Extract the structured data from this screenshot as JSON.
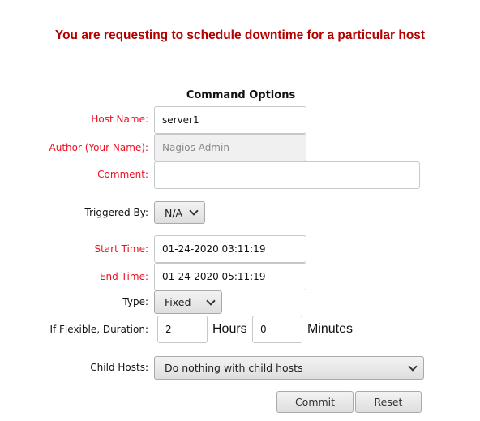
{
  "title": "You are requesting to schedule downtime for a particular host",
  "section_title": "Command Options",
  "fields": {
    "host_name": {
      "label": "Host Name:",
      "value": "server1"
    },
    "author": {
      "label": "Author (Your Name):",
      "value": "Nagios Admin"
    },
    "comment": {
      "label": "Comment:",
      "value": ""
    },
    "triggered_by": {
      "label": "Triggered By:",
      "value": "N/A"
    },
    "start_time": {
      "label": "Start Time:",
      "value": "01-24-2020 03:11:19"
    },
    "end_time": {
      "label": "End Time:",
      "value": "01-24-2020 05:11:19"
    },
    "type": {
      "label": "Type:",
      "value": "Fixed"
    },
    "duration": {
      "label": "If Flexible, Duration:",
      "hours": "2",
      "hours_label": "Hours",
      "minutes": "0",
      "minutes_label": "Minutes"
    },
    "child_hosts": {
      "label": "Child Hosts:",
      "value": "Do nothing with child hosts"
    }
  },
  "buttons": {
    "commit": "Commit",
    "reset": "Reset"
  },
  "colors": {
    "title": "#b30000",
    "required_label": "#ee1122"
  }
}
